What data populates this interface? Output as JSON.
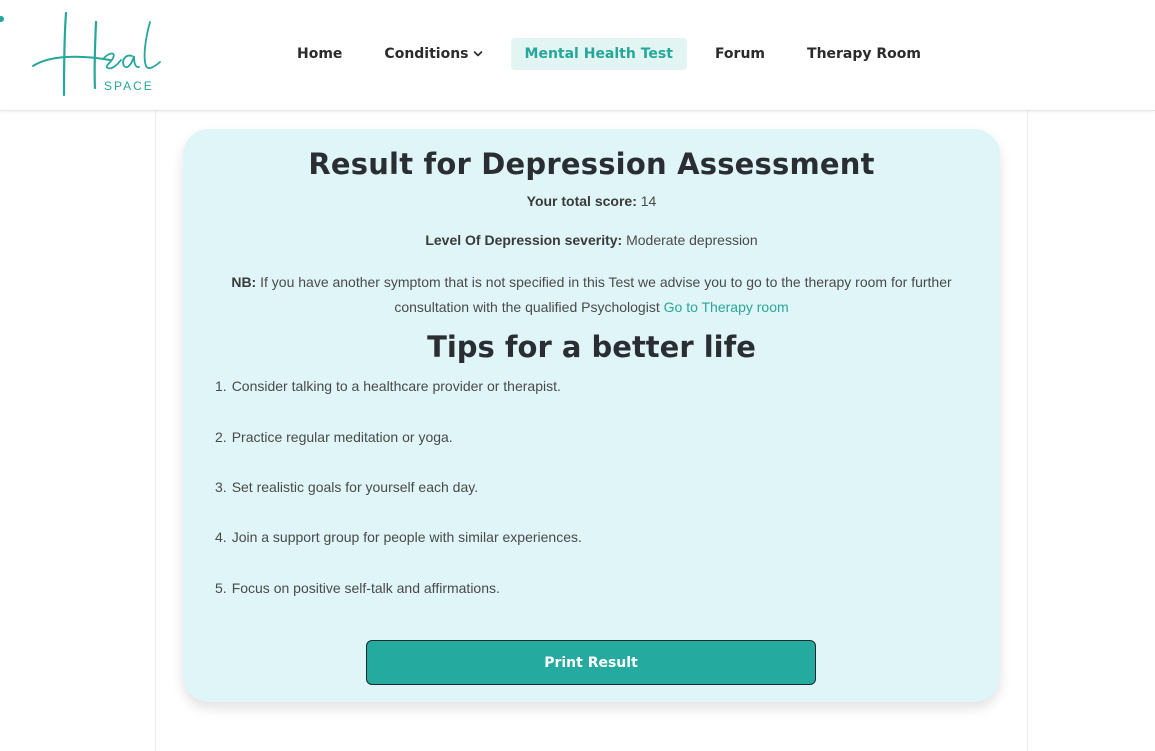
{
  "brand": {
    "logo_script": "Heal",
    "logo_sub": "SPACE",
    "accent_color": "#25a79a"
  },
  "nav": {
    "items": [
      {
        "label": "Home"
      },
      {
        "label": "Conditions",
        "has_dropdown": true
      },
      {
        "label": "Mental Health Test",
        "active": true
      },
      {
        "label": "Forum"
      },
      {
        "label": "Therapy Room"
      }
    ]
  },
  "result": {
    "title": "Result for Depression Assessment",
    "score_label": "Your total score:",
    "score_value": "14",
    "severity_label": "Level Of Depression severity:",
    "severity_value": "Moderate depression",
    "nb_label": "NB:",
    "nb_text": "If you have another symptom that is not specified in this Test we advise you to go to the therapy room for further consultation with the qualified Psychologist",
    "nb_link": "Go to Therapy room"
  },
  "tips": {
    "title": "Tips for a better life",
    "items": [
      {
        "num": "1.",
        "text": "Consider talking to a healthcare provider or therapist."
      },
      {
        "num": "2.",
        "text": "Practice regular meditation or yoga."
      },
      {
        "num": "3.",
        "text": "Set realistic goals for yourself each day."
      },
      {
        "num": "4.",
        "text": "Join a support group for people with similar experiences."
      },
      {
        "num": "5.",
        "text": "Focus on positive self-talk and affirmations."
      }
    ]
  },
  "actions": {
    "print_label": "Print Result"
  }
}
